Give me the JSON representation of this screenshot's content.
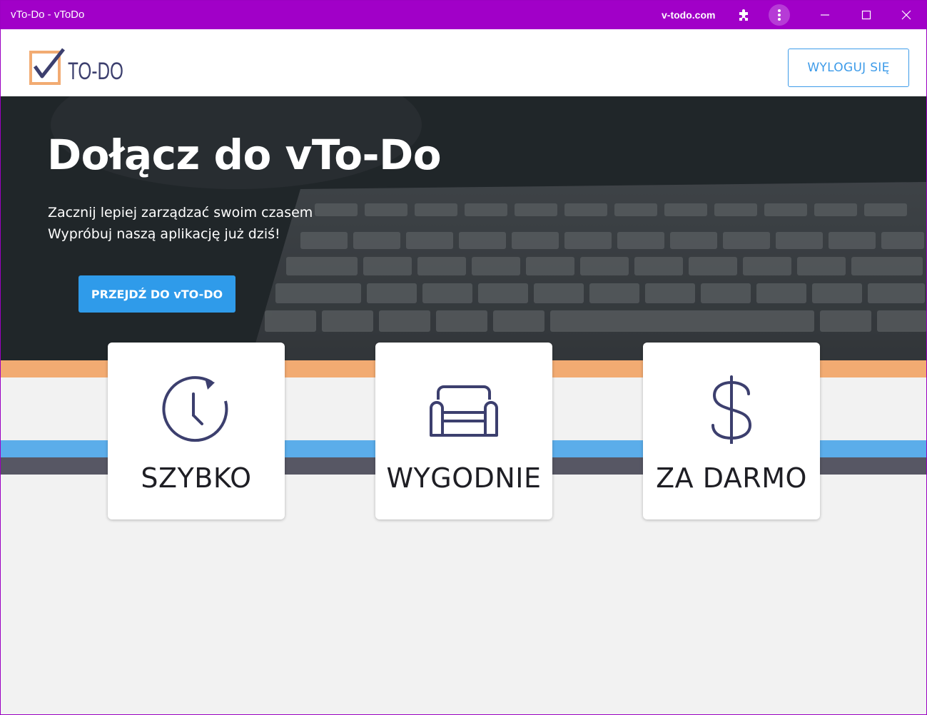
{
  "window": {
    "title": "vTo-Do - vToDo",
    "domain": "v-todo.com",
    "accent": "#a100c8"
  },
  "header": {
    "logo_text": "TO-DO",
    "logout_label": "WYLOGUJ SIĘ"
  },
  "hero": {
    "heading": "Dołącz do vTo-Do",
    "line1": "Zacznij lepiej zarządzać swoim czasem",
    "line2": "Wypróbuj naszą aplikację już dziś!",
    "cta_label": "PRZEJDŹ DO vTO-DO"
  },
  "features": [
    {
      "label": "SZYBKO",
      "icon": "clock-icon"
    },
    {
      "label": "WYGODNIE",
      "icon": "sofa-icon"
    },
    {
      "label": "ZA DARMO",
      "icon": "dollar-icon"
    }
  ],
  "colors": {
    "primary_blue": "#2f9bea",
    "orange": "#f2ab72",
    "stripe_blue": "#5badea",
    "stripe_gray": "#575764",
    "icon_navy": "#3c3f6e"
  }
}
